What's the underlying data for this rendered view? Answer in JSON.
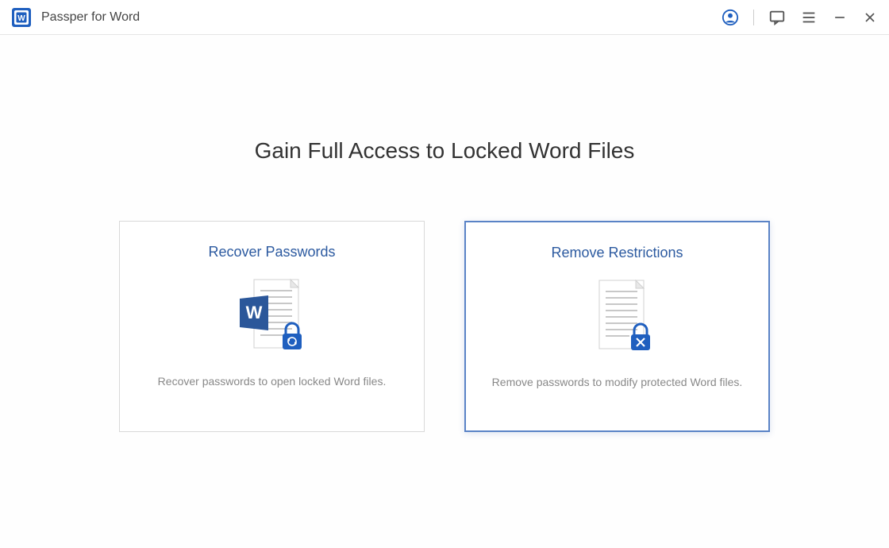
{
  "app": {
    "title": "Passper for Word"
  },
  "heading": "Gain Full Access to Locked Word Files",
  "cards": {
    "recover": {
      "title": "Recover Passwords",
      "desc": "Recover passwords to open locked Word files."
    },
    "remove": {
      "title": "Remove Restrictions",
      "desc": "Remove passwords to modify protected Word files."
    }
  },
  "colors": {
    "accent": "#2c5aa0",
    "accent_light": "#5a83c6",
    "word_blue": "#2B579A",
    "lock_blue": "#1f5fbf"
  }
}
